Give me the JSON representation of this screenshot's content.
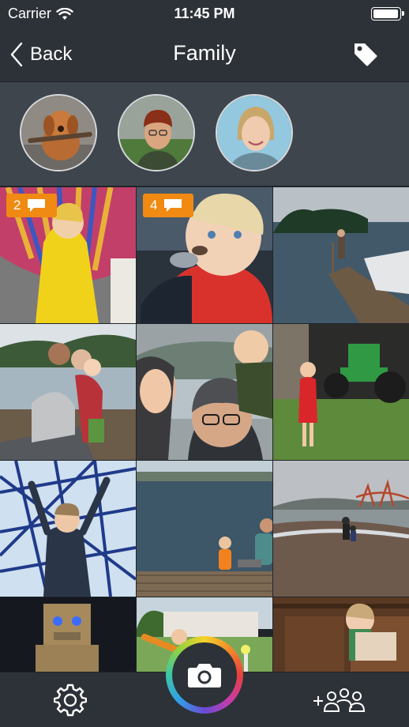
{
  "status_bar": {
    "carrier": "Carrier",
    "time": "11:45 PM",
    "battery_level": 1.0
  },
  "nav": {
    "back_label": "Back",
    "title": "Family",
    "tag_icon": "tag-icon"
  },
  "faces": [
    {
      "name": "dog-face-thumbnail"
    },
    {
      "name": "man-beanie-face-thumbnail"
    },
    {
      "name": "woman-face-thumbnail"
    }
  ],
  "photos": [
    {
      "name": "child-yellow-raincoat-umbrella",
      "comments": "2"
    },
    {
      "name": "toddler-eating-spoon",
      "comments": "4"
    },
    {
      "name": "lake-dock-boat",
      "comments": ""
    },
    {
      "name": "family-by-lake",
      "comments": ""
    },
    {
      "name": "family-selfie-coast",
      "comments": ""
    },
    {
      "name": "child-green-tractor-barn",
      "comments": ""
    },
    {
      "name": "child-climbing-rope-net",
      "comments": ""
    },
    {
      "name": "bay-pier-sitting",
      "comments": ""
    },
    {
      "name": "beach-golden-gate",
      "comments": ""
    },
    {
      "name": "child-robot-costume",
      "comments": ""
    },
    {
      "name": "park-bat-play",
      "comments": ""
    },
    {
      "name": "child-in-cabinet",
      "comments": ""
    }
  ],
  "toolbar": {
    "settings_icon": "gear-icon",
    "camera_icon": "camera-icon",
    "add_people_icon": "add-people-icon"
  },
  "colors": {
    "bar": "#2d3238",
    "faces_strip": "#3f454d",
    "badge": "#f08a12",
    "text": "#ffffff"
  }
}
